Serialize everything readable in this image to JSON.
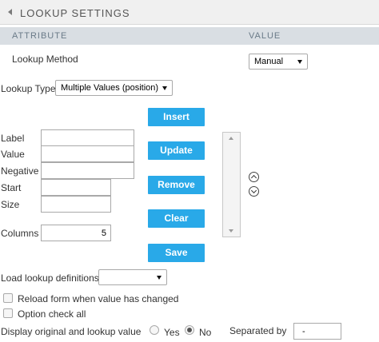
{
  "panel": {
    "title": "LOOKUP SETTINGS"
  },
  "columns": {
    "attribute": "ATTRIBUTE",
    "value": "VALUE"
  },
  "lookup_method": {
    "label": "Lookup Method",
    "value": "Manual"
  },
  "lookup_type": {
    "label": "Lookup Type",
    "value": "Multiple Values (position)"
  },
  "fields": {
    "label": "Label",
    "value": "Value",
    "negative": "Negative",
    "start": "Start",
    "size": "Size",
    "columns_label": "Columns",
    "columns_value": "5"
  },
  "buttons": {
    "insert": "Insert",
    "update": "Update",
    "remove": "Remove",
    "clear": "Clear",
    "save": "Save"
  },
  "load_definitions": {
    "label": "Load lookup definitions",
    "value": ""
  },
  "options": {
    "reload_form": "Reload form when value has changed",
    "option_check_all": "Option check all"
  },
  "display": {
    "label": "Display original and lookup value",
    "yes": "Yes",
    "no": "No",
    "selected": "No",
    "separated_by_label": "Separated by",
    "separated_by_value": "-"
  },
  "icons": {
    "collapse": "collapse-triangle-icon",
    "move_up": "chevron-up-circle-icon",
    "move_down": "chevron-down-circle-icon"
  },
  "colors": {
    "button": "#29a9e8",
    "header_bg": "#f0f0f0",
    "column_header_bg": "#d9dee3"
  }
}
